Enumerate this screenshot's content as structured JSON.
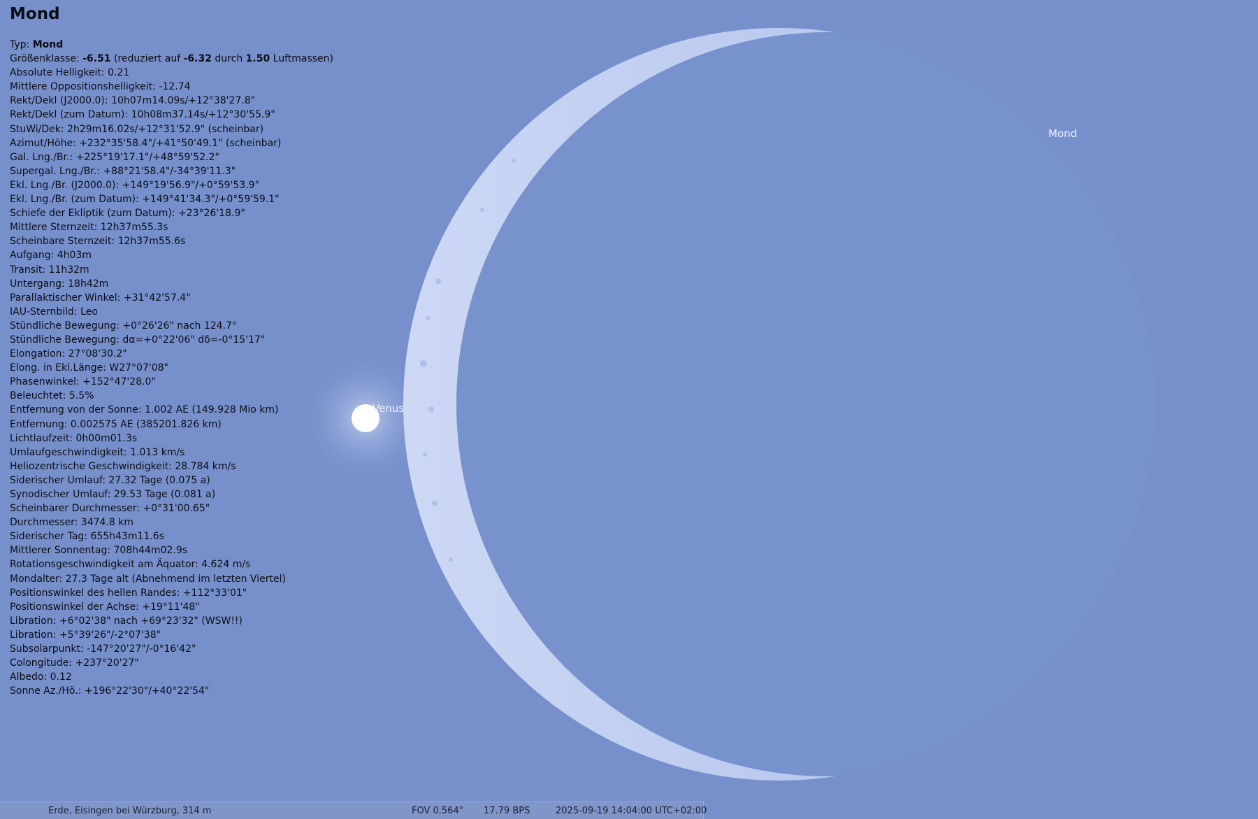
{
  "object": {
    "name": "Mond",
    "type_label": "Typ:",
    "type_value": "Mond",
    "magnitude": {
      "label": "Größenklasse:",
      "value": "-6.51",
      "reduced_prefix": "(reduziert auf",
      "reduced_value": "-6.32",
      "by": "durch",
      "airmass": "1.50",
      "airmass_suffix": "Luftmassen)"
    },
    "lines": [
      "Absolute Helligkeit: 0.21",
      "Mittlere Oppositionshelligkeit: -12.74",
      "Rekt/Dekl (J2000.0): 10h07m14.09s/+12°38'27.8\"",
      "Rekt/Dekl (zum Datum): 10h08m37.14s/+12°30'55.9\"",
      "StuWi/Dek: 2h29m16.02s/+12°31'52.9\" (scheinbar)",
      "Azimut/Höhe: +232°35'58.4\"/+41°50'49.1\" (scheinbar)",
      "Gal. Lng./Br.: +225°19'17.1\"/+48°59'52.2\"",
      "Supergal. Lng./Br.: +88°21'58.4\"/-34°39'11.3\"",
      "Ekl. Lng./Br. (J2000.0): +149°19'56.9\"/+0°59'53.9\"",
      "Ekl. Lng./Br. (zum Datum): +149°41'34.3\"/+0°59'59.1\"",
      "Schiefe der Ekliptik (zum Datum): +23°26'18.9\"",
      "Mittlere Sternzeit: 12h37m55.3s",
      "Scheinbare Sternzeit: 12h37m55.6s",
      "Aufgang: 4h03m",
      "Transit: 11h32m",
      "Untergang: 18h42m",
      "Parallaktischer Winkel: +31°42'57.4\"",
      "IAU-Sternbild: Leo",
      "Stündliche Bewegung: +0°26'26\" nach 124.7°",
      "Stündliche Bewegung: dα=+0°22'06\" dδ=-0°15'17\"",
      "Elongation: 27°08'30.2\"",
      "Elong. in Ekl.Länge: W27°07'08\"",
      "Phasenwinkel: +152°47'28.0\"",
      "Beleuchtet: 5.5%",
      "Entfernung von der Sonne: 1.002 AE (149.928 Mio km)",
      "Entfernung: 0.002575 AE (385201.826 km)",
      "Lichtlaufzeit: 0h00m01.3s",
      "Umlaufgeschwindigkeit: 1.013 km/s",
      "Heliozentrische Geschwindigkeit: 28.784 km/s",
      "Siderischer Umlauf: 27.32 Tage (0.075 a)",
      "Synodischer Umlauf: 29.53 Tage (0.081 a)",
      "Scheinbarer Durchmesser: +0°31'00.65\"",
      "Durchmesser: 3474.8 km",
      "Siderischer Tag: 655h43m11.6s",
      "Mittlerer Sonnentag: 708h44m02.9s",
      "Rotationsgeschwindigkeit am Äquator: 4.624 m/s",
      "Mondalter: 27.3 Tage alt (Abnehmend im letzten Viertel)",
      "Positionswinkel des hellen Randes: +112°33'01\"",
      "Positionswinkel der Achse: +19°11'48\"",
      "Libration: +6°02'38\" nach +69°23'32\" (WSW!!)",
      "Libration: +5°39'26\"/-2°07'38\"",
      "Subsolarpunkt: -147°20'27\"/-0°16'42\"",
      "Colongitude: +237°20'27\"",
      "Albedo: 0.12",
      "Sonne Az./Hö.: +196°22'30\"/+40°22'54\""
    ]
  },
  "sky": {
    "moon_label": "Mond",
    "venus_label": "Venus",
    "background_color": "#7790cc",
    "crescent_color": "#c9d6f2"
  },
  "status": {
    "location": "Erde, Eisingen bei Würzburg, 314 m",
    "fov": "FOV 0.564°",
    "fps": "17.79 BPS",
    "datetime": "2025-09-19 14:04:00 UTC+02:00"
  }
}
